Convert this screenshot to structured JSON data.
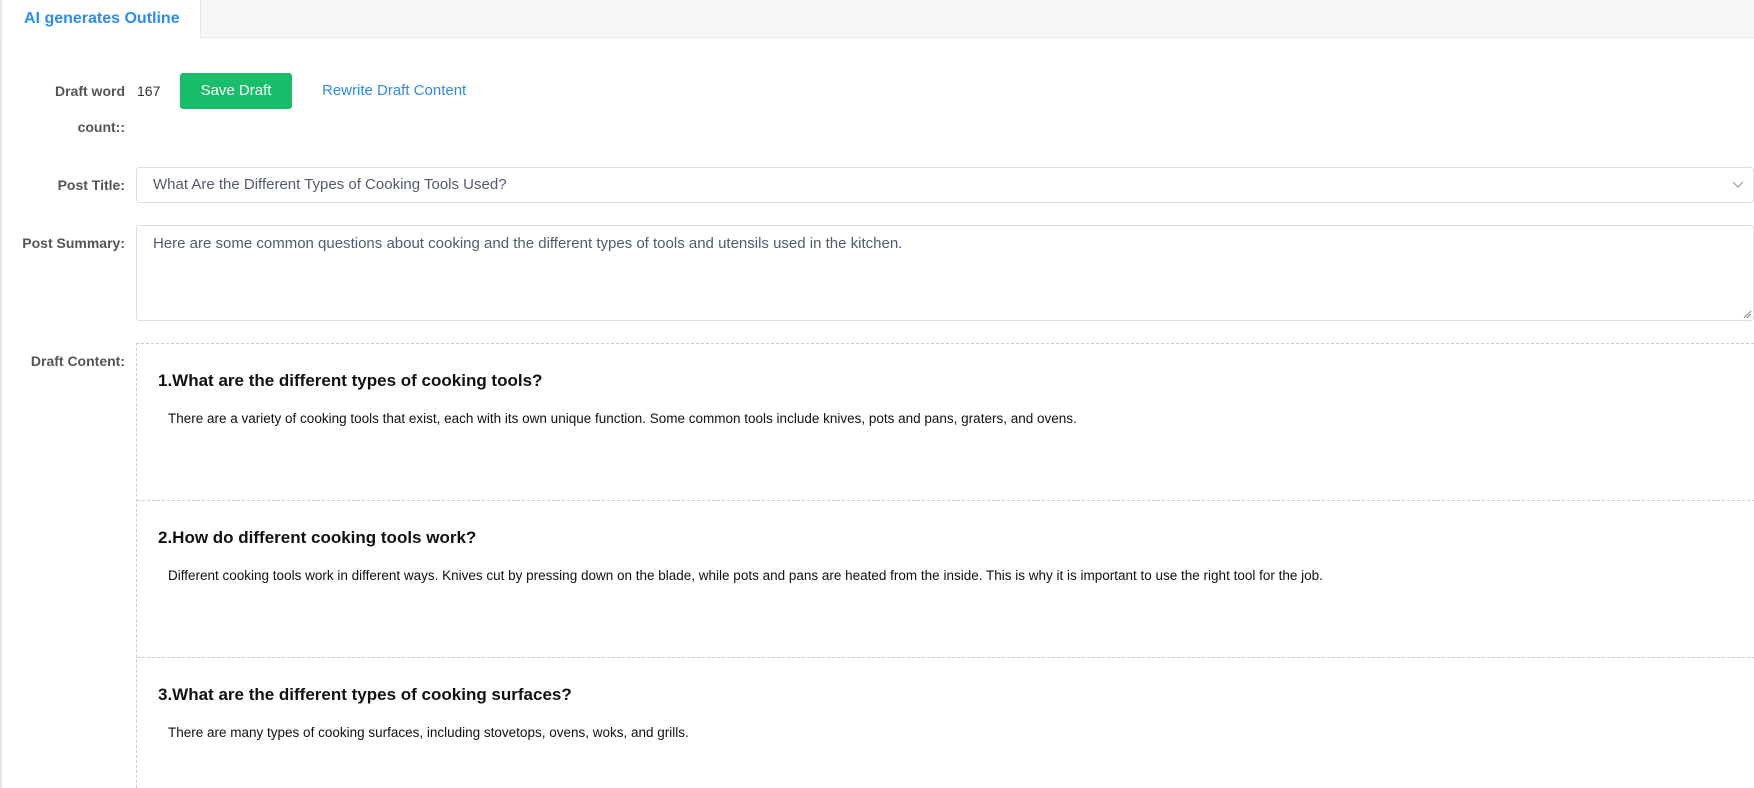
{
  "tabs": [
    {
      "label": "AI generates Outline",
      "active": true
    }
  ],
  "form": {
    "word_count_label_line1": "Draft word",
    "word_count_label_line2": "count::",
    "word_count_value": "167",
    "save_draft_label": "Save Draft",
    "rewrite_label": "Rewrite Draft Content",
    "post_title_label": "Post Title:",
    "post_title_value": "What Are the Different Types of Cooking Tools Used?",
    "post_summary_label": "Post Summary:",
    "post_summary_value": "Here are some common questions about cooking and the different types of tools and utensils used in the kitchen.",
    "draft_content_label": "Draft Content:"
  },
  "draft_sections": [
    {
      "title": "1.What are the different types of cooking tools?",
      "body": "There are a variety of cooking tools that exist, each with its own unique function. Some common tools include knives, pots and pans, graters, and ovens."
    },
    {
      "title": "2.How do different cooking tools work?",
      "body": "Different cooking tools work in different ways. Knives cut by pressing down on the blade, while pots and pans are heated from the inside. This is why it is important to use the right tool for the job."
    },
    {
      "title": "3.What are the different types of cooking surfaces?",
      "body": "There are many types of cooking surfaces, including stovetops, ovens, woks, and grills."
    }
  ],
  "icons": {
    "select_arrow": "chevron-down-icon",
    "textarea_resize": "resize-grip-icon"
  },
  "colors": {
    "accent_blue": "#2d8cf0",
    "save_green": "#19be6b"
  }
}
